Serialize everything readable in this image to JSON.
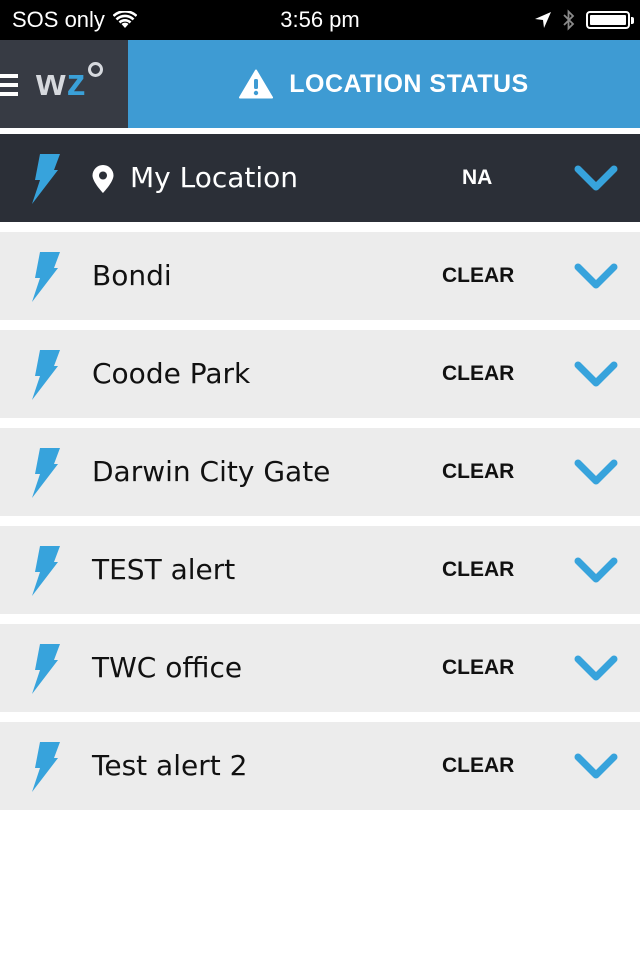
{
  "status_bar": {
    "carrier": "SOS only",
    "time": "3:56 pm",
    "icons": [
      "wifi-icon",
      "location-arrow-icon",
      "bluetooth-icon",
      "battery-icon"
    ]
  },
  "header": {
    "logo_w": "w",
    "logo_z": "z",
    "title": "LOCATION STATUS",
    "title_icon": "warning-triangle-icon",
    "menu_icon": "hamburger-menu-icon"
  },
  "colors": {
    "accent": "#3e9bd3",
    "bolt": "#37a3dc",
    "dark_row": "#2b2f37",
    "logo_bg": "#373b44",
    "row_bg": "#ececec"
  },
  "my_location": {
    "name": "My Location",
    "status": "NA"
  },
  "locations": [
    {
      "name": "Bondi",
      "status": "CLEAR"
    },
    {
      "name": "Coode Park",
      "status": "CLEAR"
    },
    {
      "name": "Darwin City Gate",
      "status": "CLEAR"
    },
    {
      "name": "TEST alert",
      "status": "CLEAR"
    },
    {
      "name": "TWC office",
      "status": "CLEAR"
    },
    {
      "name": "Test alert 2",
      "status": "CLEAR"
    }
  ]
}
